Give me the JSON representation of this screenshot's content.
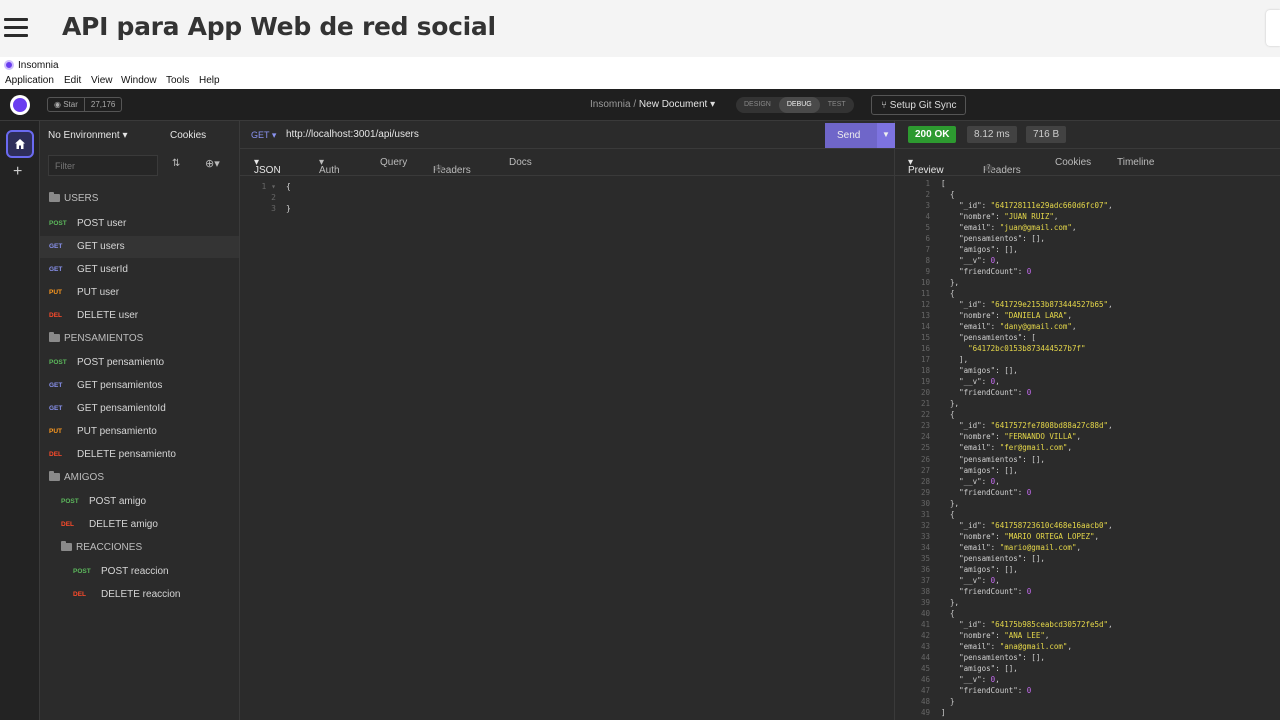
{
  "page": {
    "title": "API para App Web de red social"
  },
  "window": {
    "title": "Insomnia",
    "menu": [
      "Application",
      "Edit",
      "View",
      "Window",
      "Tools",
      "Help"
    ]
  },
  "topbar": {
    "star_label": "Star",
    "star_count": "27,176",
    "breadcrumb_root": "Insomnia",
    "breadcrumb_sep": "/",
    "breadcrumb_doc": "New Document",
    "modes": [
      "DESIGN",
      "DEBUG",
      "TEST"
    ],
    "active_mode": "DEBUG",
    "git_sync": "Setup Git Sync"
  },
  "sidebar": {
    "environment": "No Environment",
    "cookies": "Cookies",
    "filter_placeholder": "Filter",
    "method_colors": {
      "POST": "#5cb85c",
      "GET": "#8a93f0",
      "PUT": "#ff9a1f",
      "DEL": "#ff4b2b"
    },
    "items": [
      {
        "type": "folder",
        "name": "USERS"
      },
      {
        "type": "request",
        "method": "POST",
        "name": "POST user"
      },
      {
        "type": "request",
        "method": "GET",
        "name": "GET users",
        "active": true
      },
      {
        "type": "request",
        "method": "GET",
        "name": "GET userId"
      },
      {
        "type": "request",
        "method": "PUT",
        "name": "PUT user"
      },
      {
        "type": "request",
        "method": "DEL",
        "name": "DELETE user"
      },
      {
        "type": "folder",
        "name": "PENSAMIENTOS"
      },
      {
        "type": "request",
        "method": "POST",
        "name": "POST pensamiento"
      },
      {
        "type": "request",
        "method": "GET",
        "name": "GET pensamientos"
      },
      {
        "type": "request",
        "method": "GET",
        "name": "GET pensamientoId"
      },
      {
        "type": "request",
        "method": "PUT",
        "name": "PUT pensamiento"
      },
      {
        "type": "request",
        "method": "DEL",
        "name": "DELETE pensamiento"
      },
      {
        "type": "folder",
        "name": "AMIGOS"
      },
      {
        "type": "request",
        "method": "POST",
        "name": "POST amigo"
      },
      {
        "type": "request",
        "method": "DEL",
        "name": "DELETE amigo"
      },
      {
        "type": "folder",
        "name": "REACCIONES"
      },
      {
        "type": "request",
        "method": "POST",
        "name": "POST reaccion"
      },
      {
        "type": "request",
        "method": "DEL",
        "name": "DELETE reaccion"
      }
    ]
  },
  "request": {
    "method": "GET",
    "url": "http://localhost:3001/api/users",
    "send": "Send",
    "tabs": {
      "body": "JSON",
      "auth": "Auth",
      "query": "Query",
      "headers": "Headers",
      "headers_count": "1",
      "docs": "Docs"
    },
    "body_lines": [
      "{",
      "",
      "}"
    ]
  },
  "response": {
    "status": "200 OK",
    "time": "8.12 ms",
    "size": "716 B",
    "tabs": {
      "preview": "Preview",
      "headers": "Headers",
      "headers_count": "7",
      "cookies": "Cookies",
      "timeline": "Timeline"
    },
    "lines": [
      "[",
      "  {",
      "    \"_id\": \"641728111e29adc660d6fc07\",",
      "    \"nombre\": \"JUAN RUIZ\",",
      "    \"email\": \"juan@gmail.com\",",
      "    \"pensamientos\": [],",
      "    \"amigos\": [],",
      "    \"__v\": 0,",
      "    \"friendCount\": 0",
      "  },",
      "  {",
      "    \"_id\": \"641729e2153b873444527b65\",",
      "    \"nombre\": \"DANIELA LARA\",",
      "    \"email\": \"dany@gmail.com\",",
      "    \"pensamientos\": [",
      "      \"64172bc0153b873444527b7f\"",
      "    ],",
      "    \"amigos\": [],",
      "    \"__v\": 0,",
      "    \"friendCount\": 0",
      "  },",
      "  {",
      "    \"_id\": \"6417572fe7808bd88a27c88d\",",
      "    \"nombre\": \"FERNANDO VILLA\",",
      "    \"email\": \"fer@gmail.com\",",
      "    \"pensamientos\": [],",
      "    \"amigos\": [],",
      "    \"__v\": 0,",
      "    \"friendCount\": 0",
      "  },",
      "  {",
      "    \"_id\": \"641758723610c468e16aacb0\",",
      "    \"nombre\": \"MARIO ORTEGA LOPEZ\",",
      "    \"email\": \"mario@gmail.com\",",
      "    \"pensamientos\": [],",
      "    \"amigos\": [],",
      "    \"__v\": 0,",
      "    \"friendCount\": 0",
      "  },",
      "  {",
      "    \"_id\": \"64175b985ceabcd30572fe5d\",",
      "    \"nombre\": \"ANA LEE\",",
      "    \"email\": \"ana@gmail.com\",",
      "    \"pensamientos\": [],",
      "    \"amigos\": [],",
      "    \"__v\": 0,",
      "    \"friendCount\": 0",
      "  }",
      "]"
    ]
  }
}
